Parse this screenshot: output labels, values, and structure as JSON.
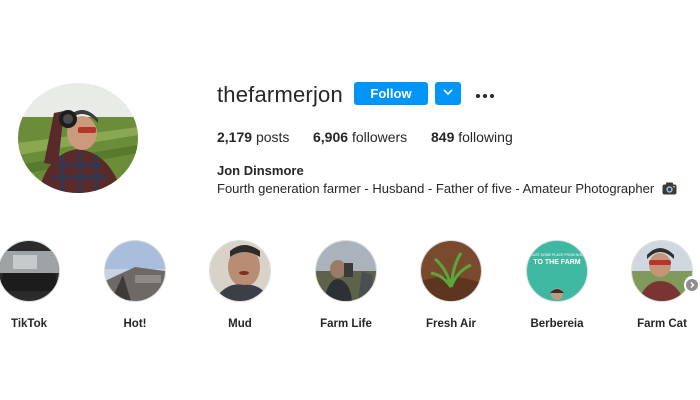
{
  "profile": {
    "username": "thefarmerjon",
    "follow_label": "Follow",
    "stats": {
      "posts_count": "2,179",
      "posts_label": "posts",
      "followers_count": "6,906",
      "followers_label": "followers",
      "following_count": "849",
      "following_label": "following"
    },
    "full_name": "Jon Dinsmore",
    "bio": "Fourth generation farmer - Husband - Father of five - Amateur Photographer"
  },
  "highlights": [
    {
      "label": "TikTok"
    },
    {
      "label": "Hot!"
    },
    {
      "label": "Mud"
    },
    {
      "label": "Farm Life"
    },
    {
      "label": "Fresh Air"
    },
    {
      "label": "Berbereia",
      "cover_text_small": "JUST SOME PLACE FROM NOWHERE",
      "cover_text": "TO THE FARM"
    },
    {
      "label": "Farm Cat"
    }
  ],
  "icons": {
    "dropdown": "chevron-down-icon",
    "more": "more-options-icon",
    "bio_emoji": "camera-icon",
    "next": "chevron-right-icon"
  },
  "colors": {
    "accent": "#0095f6",
    "text": "#262626"
  }
}
